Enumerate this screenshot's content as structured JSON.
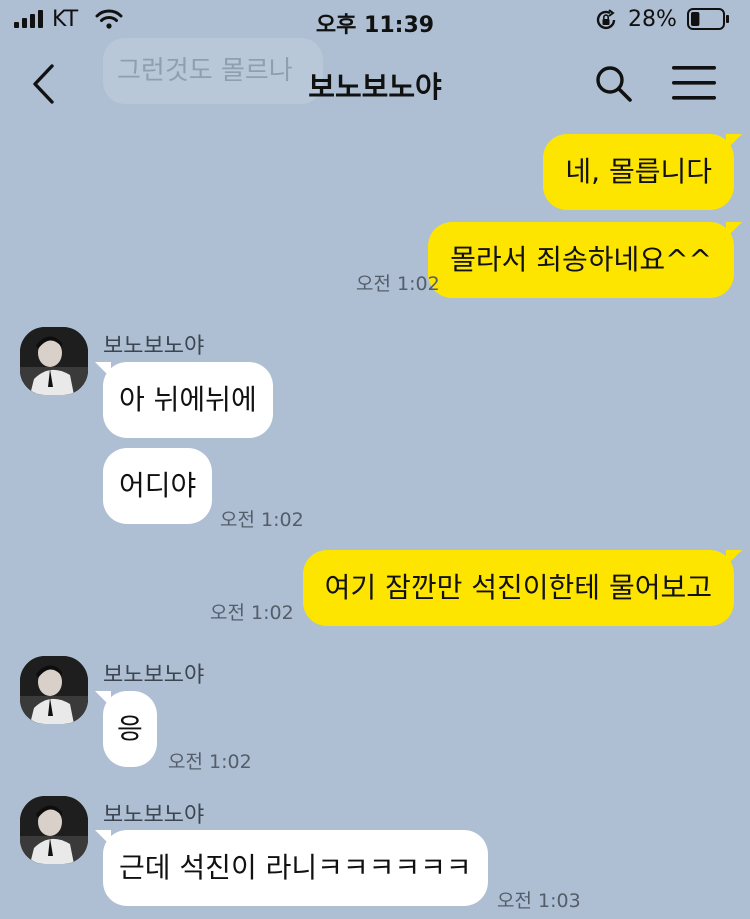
{
  "status_bar": {
    "carrier": "KT",
    "time": "오후 11:39",
    "battery": "28%",
    "battery_level": 0.28
  },
  "header": {
    "title": "보노보노야",
    "ghost_text": "그런것도 몰르나"
  },
  "messages": [
    {
      "side": "me",
      "text": "네, 몰릅니다"
    },
    {
      "side": "me",
      "text": "몰라서 죄송하네요^^",
      "time": "오전 1:02"
    },
    {
      "side": "them",
      "sender": "보노보노야",
      "text": "아 뉘에뉘에"
    },
    {
      "side": "them",
      "text": "어디야",
      "time": "오전 1:02"
    },
    {
      "side": "me",
      "text": "여기 잠깐만 석진이한테 물어보고",
      "time": "오전 1:02"
    },
    {
      "side": "them",
      "sender": "보노보노야",
      "text": "응",
      "time": "오전 1:02"
    },
    {
      "side": "them",
      "sender": "보노보노야",
      "text": "근데 석진이 라니ㅋㅋㅋㅋㅋㅋ",
      "time": "오전 1:03"
    }
  ],
  "icons": [
    "signal-icon",
    "wifi-icon",
    "rotation-lock-icon",
    "battery-icon",
    "back-icon",
    "search-icon",
    "menu-icon"
  ]
}
